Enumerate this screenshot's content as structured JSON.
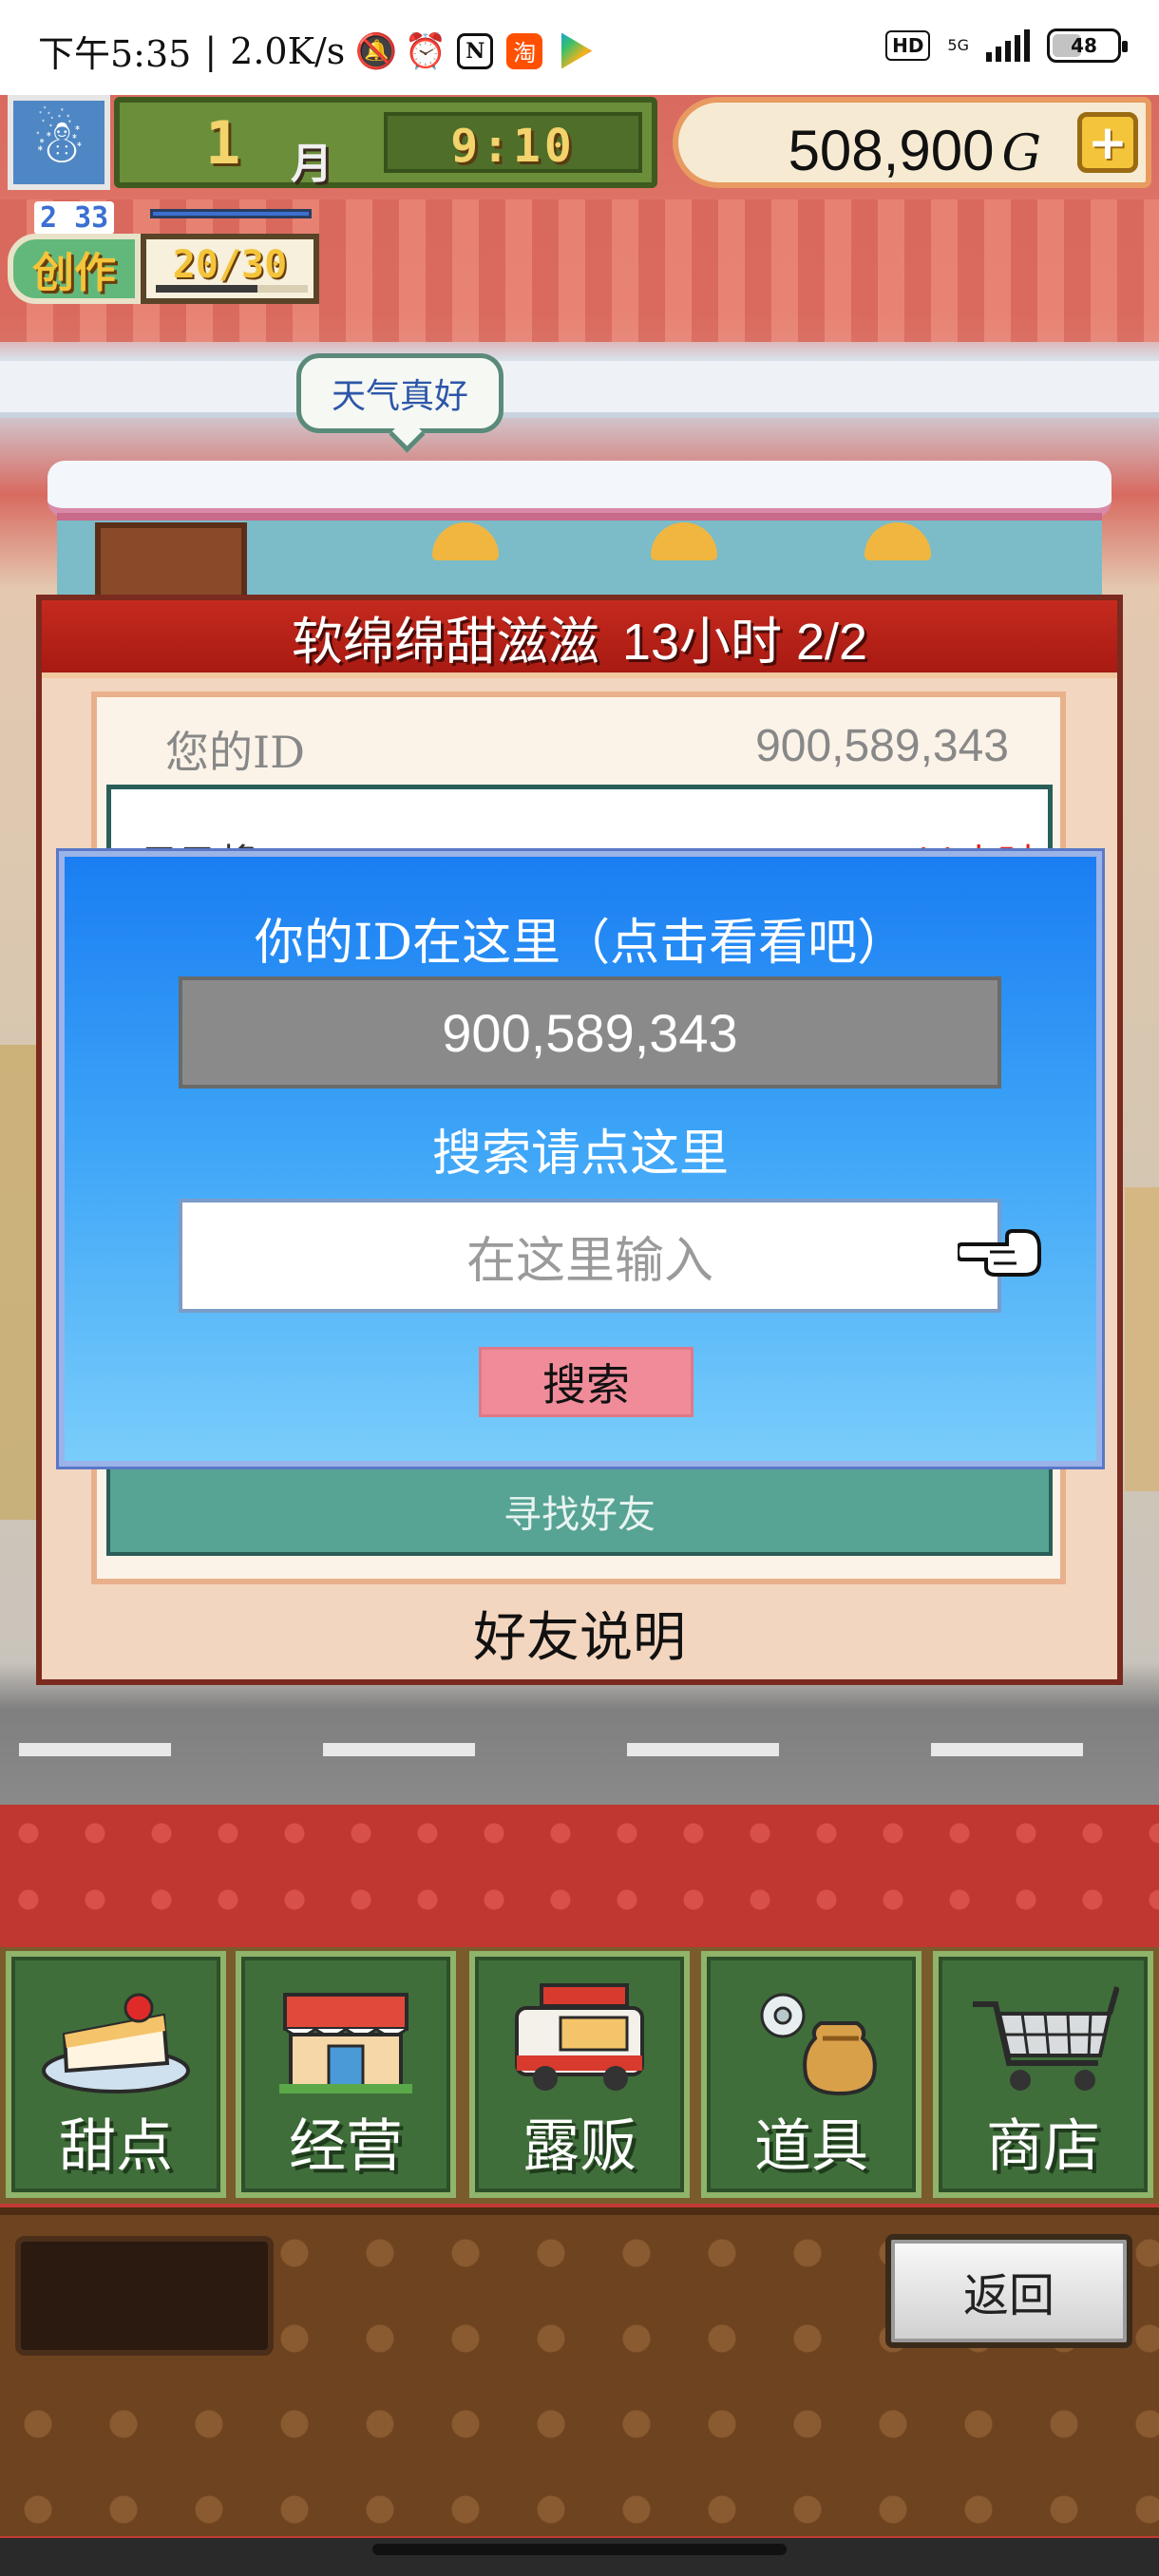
{
  "status_bar": {
    "time": "下午5:35",
    "net_speed": "2.0K/s",
    "hd_badge": "HD",
    "net_type": "5G",
    "battery": "48",
    "icons": [
      "bell-off-icon",
      "alarm-icon",
      "nfc-icon",
      "taobao-icon",
      "play-store-icon"
    ]
  },
  "hud": {
    "month_number": "1",
    "month_label": "月",
    "time": "9:10",
    "money": "508,900",
    "money_unit": "G",
    "plus_label": "+"
  },
  "create_meter": {
    "small_value": "2 33",
    "label": "创作",
    "count": "20/30",
    "progress_fraction": 0.67
  },
  "speech_bubble": "天气真好",
  "panel": {
    "header_title": "软绵绵甜滋滋",
    "header_time": "13小时 2/2",
    "id_label": "您的ID",
    "id_value": "900,589,343",
    "list_peek_left": "乙乙将",
    "list_peek_right": "11小时",
    "find_friend": "寻找好友",
    "friend_info": "好友说明"
  },
  "dialog": {
    "title": "你的ID在这里（点击看看吧）",
    "id_value": "900,589,343",
    "search_label": "搜索请点这里",
    "input_placeholder": "在这里输入",
    "search_button": "搜索"
  },
  "menu": [
    {
      "label": "甜点",
      "icon": "cake-icon"
    },
    {
      "label": "经营",
      "icon": "shop-building-icon"
    },
    {
      "label": "露贩",
      "icon": "food-truck-icon"
    },
    {
      "label": "道具",
      "icon": "items-bag-icon"
    },
    {
      "label": "商店",
      "icon": "shopping-cart-icon"
    }
  ],
  "back_button": "返回",
  "colors": {
    "dialog_blue": "#1a7ef2",
    "panel_red": "#c52a1e",
    "search_button_pink": "#f08c9a",
    "menu_green": "#3f6e3a"
  }
}
